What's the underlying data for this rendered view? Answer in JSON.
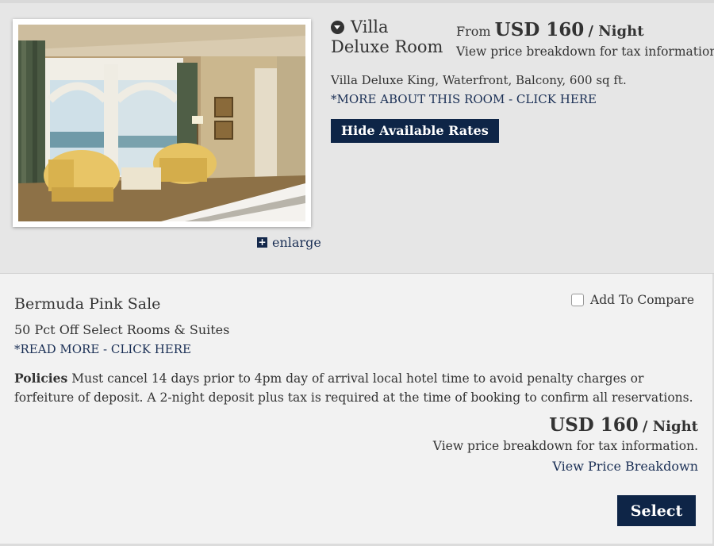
{
  "room": {
    "title": "Villa Deluxe Room",
    "from_label": "From",
    "from_price": "USD 160",
    "per_night": "/ Night",
    "price_note": "View price breakdown for tax information.",
    "description": "Villa Deluxe King, Waterfront, Balcony, 600 sq ft.",
    "more_link": "*MORE ABOUT THIS ROOM - CLICK HERE",
    "hide_rates_label": "Hide Available Rates",
    "enlarge_label": "enlarge"
  },
  "rate": {
    "name": "Bermuda Pink Sale",
    "compare_label": "Add To Compare",
    "compare_checked": false,
    "subtitle": "50 Pct Off Select Rooms & Suites",
    "read_more": "*READ MORE - CLICK HERE",
    "policies_label": "Policies",
    "policies_text": "Must cancel 14 days prior to 4pm day of arrival local hotel time to avoid penalty charges or forfeiture of deposit. A 2-night deposit plus tax is required at the time of booking to confirm all reservations.",
    "price": "USD 160",
    "per_night": "/ Night",
    "price_note": "View price breakdown for tax information.",
    "breakdown_link": "View Price Breakdown",
    "select_label": "Select"
  },
  "colors": {
    "navy": "#0e2547",
    "link": "#1a2f55",
    "panel_top": "#e6e6e6",
    "panel_bottom": "#f2f2f2"
  }
}
